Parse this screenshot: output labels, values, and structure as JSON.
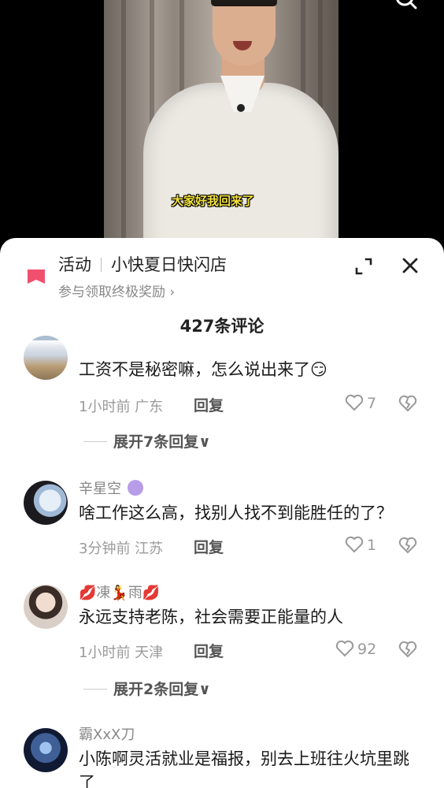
{
  "video": {
    "subtitle": "大家好我回来了",
    "icons": {
      "search": "search-icon"
    }
  },
  "promo": {
    "label": "活动",
    "title": "小快夏日快闪店",
    "subtitle": "参与领取终极奖励 ›",
    "flag_color": "#f0506e"
  },
  "comments_header": {
    "count_label": "427条评论"
  },
  "comments": [
    {
      "user": "",
      "text": "工资不是秘密嘛，怎么说出来了😏",
      "time_location": "1小时前 广东",
      "reply": "回复",
      "likes": "7",
      "more": "展开7条回复∨"
    },
    {
      "user": "辛星空",
      "text": "啥工作这么高，找别人找不到能胜任的了？",
      "time_location": "3分钟前 江苏",
      "reply": "回复",
      "likes": "1"
    },
    {
      "user": "💋凍💃雨💋",
      "text": "永远支持老陈，社会需要正能量的人",
      "time_location": "1小时前 天津",
      "reply": "回复",
      "likes": "92",
      "more": "展开2条回复∨"
    },
    {
      "user": "霸XxX刀",
      "text": "小陈啊灵活就业是福报，别去上班往火坑里跳了"
    }
  ]
}
